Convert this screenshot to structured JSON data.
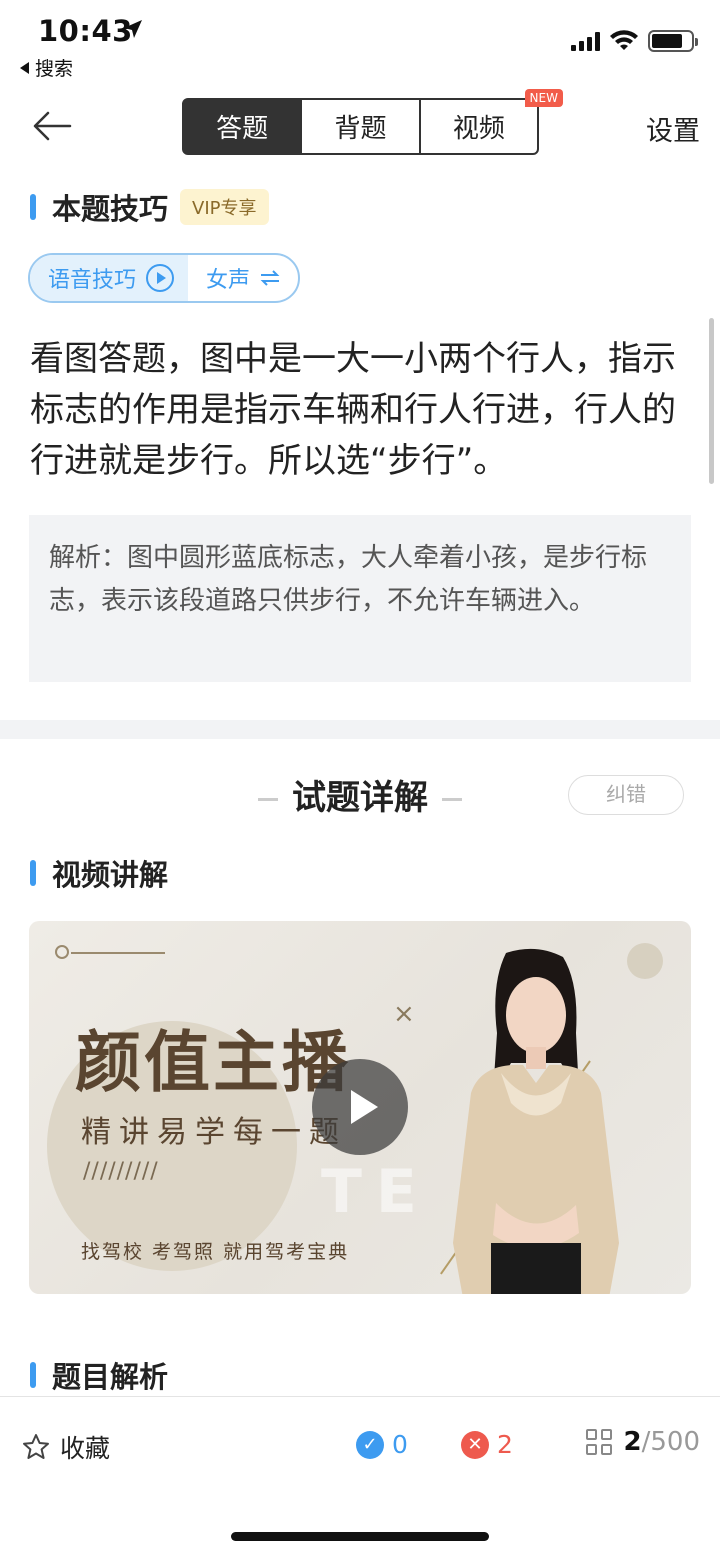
{
  "status_bar": {
    "time": "10:43",
    "back_app": "搜索"
  },
  "nav": {
    "tabs": [
      {
        "label": "答题",
        "active": true
      },
      {
        "label": "背题",
        "active": false
      },
      {
        "label": "视频",
        "active": false,
        "badge": "NEW"
      }
    ],
    "settings": "设置"
  },
  "tips": {
    "section_title": "本题技巧",
    "vip_badge": "VIP专享",
    "voice_tip": "语音技巧",
    "voice_gender": "女声",
    "text": "看图答题，图中是一大一小两个行人，指示标志的作用是指示车辆和行人行进，行人的行进就是步行。所以选“步行”。",
    "analysis": "解析：图中圆形蓝底标志，大人牵着小孩，是步行标志，表示该段道路只供步行，不允许车辆进入。"
  },
  "detail": {
    "title": "试题详解",
    "correct_button": "纠错",
    "video_section_title": "视频讲解",
    "video": {
      "headline": "颜值主播",
      "subline": "精讲易学每一题",
      "hash": "/////////",
      "footer": "找驾校  考驾照  就用驾考宝典",
      "watermark": "TE   R"
    },
    "analysis_section_title": "题目解析"
  },
  "toolbar": {
    "favorite": "收藏",
    "correct_count": "0",
    "wrong_count": "2",
    "current": "2",
    "total": "/500"
  },
  "colors": {
    "accent": "#3d9bf0",
    "wrong": "#ee5a4e",
    "vip_bg": "#fdf3d0"
  }
}
